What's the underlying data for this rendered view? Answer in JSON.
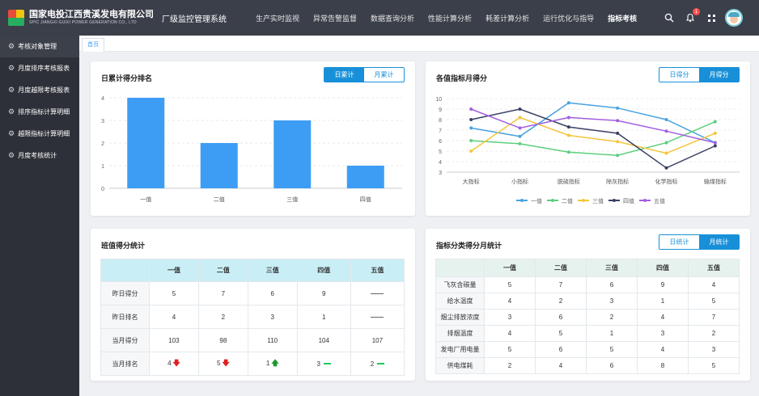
{
  "header": {
    "company_cn": "国家电投江西贵溪发电有限公司",
    "company_en": "SPIC JIANGXI GUIXI POWER GENERATION CO., LTD",
    "system_name": "厂级监控管理系统",
    "nav": [
      "生产实时监视",
      "异常告警监督",
      "数据查询分析",
      "性能计算分析",
      "耗差计算分析",
      "运行优化与指导",
      "指标考核"
    ],
    "active_nav": "指标考核",
    "notification_count": "1",
    "icons": [
      "search-icon",
      "bell-icon",
      "fullscreen-icon",
      "avatar"
    ]
  },
  "sidebar": {
    "items": [
      {
        "label": "考核对象管理",
        "active": true
      },
      {
        "label": "月度排序考核报表",
        "active": false
      },
      {
        "label": "月度越限考核报表",
        "active": false
      },
      {
        "label": "排序指标计算明细",
        "active": false
      },
      {
        "label": "越限指标计算明细",
        "active": false
      },
      {
        "label": "月度考核统计",
        "active": false
      }
    ]
  },
  "tabs": {
    "home": "首页"
  },
  "daily_rank": {
    "title": "日累计得分排名",
    "toggle": [
      "日累计",
      "月累计"
    ],
    "toggle_active": 0
  },
  "indicator_score": {
    "title": "各值指标月得分",
    "toggle": [
      "日得分",
      "月得分"
    ],
    "toggle_active": 1
  },
  "shift_stats": {
    "title": "班值得分统计",
    "columns": [
      "一值",
      "二值",
      "三值",
      "四值",
      "五值"
    ],
    "rows": [
      {
        "label": "昨日得分",
        "cells": [
          "5",
          "7",
          "6",
          "9",
          ""
        ]
      },
      {
        "label": "昨日排名",
        "cells": [
          "4",
          "2",
          "3",
          "1",
          ""
        ]
      },
      {
        "label": "当月得分",
        "cells": [
          "103",
          "98",
          "110",
          "104",
          "107"
        ]
      },
      {
        "label": "当月排名",
        "cells": [
          "4",
          "5",
          "1",
          "3",
          "2"
        ]
      }
    ],
    "rank_trend": [
      "down",
      "down",
      "up",
      "flat",
      "flat"
    ]
  },
  "category_stats": {
    "title": "指标分类得分月统计",
    "toggle": [
      "日统计",
      "月统计"
    ],
    "toggle_active": 1,
    "columns": [
      "一值",
      "二值",
      "三值",
      "四值",
      "五值"
    ],
    "rows": [
      {
        "label": "飞灰含碳量",
        "cells": [
          "5",
          "7",
          "6",
          "9",
          "4"
        ]
      },
      {
        "label": "给水温度",
        "cells": [
          "4",
          "2",
          "3",
          "1",
          "5"
        ]
      },
      {
        "label": "烟尘排放浓度",
        "cells": [
          "3",
          "6",
          "2",
          "4",
          "7"
        ]
      },
      {
        "label": "排烟温度",
        "cells": [
          "4",
          "5",
          "1",
          "3",
          "2"
        ]
      },
      {
        "label": "发电厂用电量",
        "cells": [
          "5",
          "6",
          "5",
          "4",
          "3"
        ]
      },
      {
        "label": "供电煤耗",
        "cells": [
          "2",
          "4",
          "6",
          "8",
          "5"
        ]
      }
    ]
  },
  "chart_data": [
    {
      "type": "bar",
      "categories": [
        "一值",
        "二值",
        "三值",
        "四值"
      ],
      "values": [
        4,
        2,
        3,
        1
      ],
      "ylim": [
        0,
        4
      ],
      "yticks": [
        0,
        1,
        2,
        3,
        4
      ],
      "grid": true,
      "color": "#3d9df5"
    },
    {
      "type": "line",
      "categories": [
        "大指标",
        "小指标",
        "脱硫指标",
        "除灰指标",
        "化学指标",
        "输煤指标"
      ],
      "ylim": [
        3,
        10
      ],
      "yticks": [
        3,
        4,
        5,
        6,
        7,
        8,
        9,
        10
      ],
      "legend_position": "bottom",
      "grid": true,
      "series": [
        {
          "name": "一值",
          "color": "#4aa3df",
          "values": [
            7.2,
            6.4,
            9.6,
            9.1,
            8.0,
            5.8
          ]
        },
        {
          "name": "二值",
          "color": "#5ccf7e",
          "values": [
            6.0,
            5.7,
            4.9,
            4.6,
            5.8,
            7.8
          ]
        },
        {
          "name": "三值",
          "color": "#f3c63c",
          "values": [
            5.0,
            8.2,
            6.5,
            5.9,
            4.8,
            6.7
          ]
        },
        {
          "name": "四值",
          "color": "#3a3f63",
          "values": [
            8.0,
            9.0,
            7.3,
            6.7,
            3.4,
            5.5
          ]
        },
        {
          "name": "五值",
          "color": "#a25ee0",
          "values": [
            9.0,
            7.2,
            8.2,
            7.9,
            6.9,
            5.8
          ]
        }
      ]
    }
  ]
}
